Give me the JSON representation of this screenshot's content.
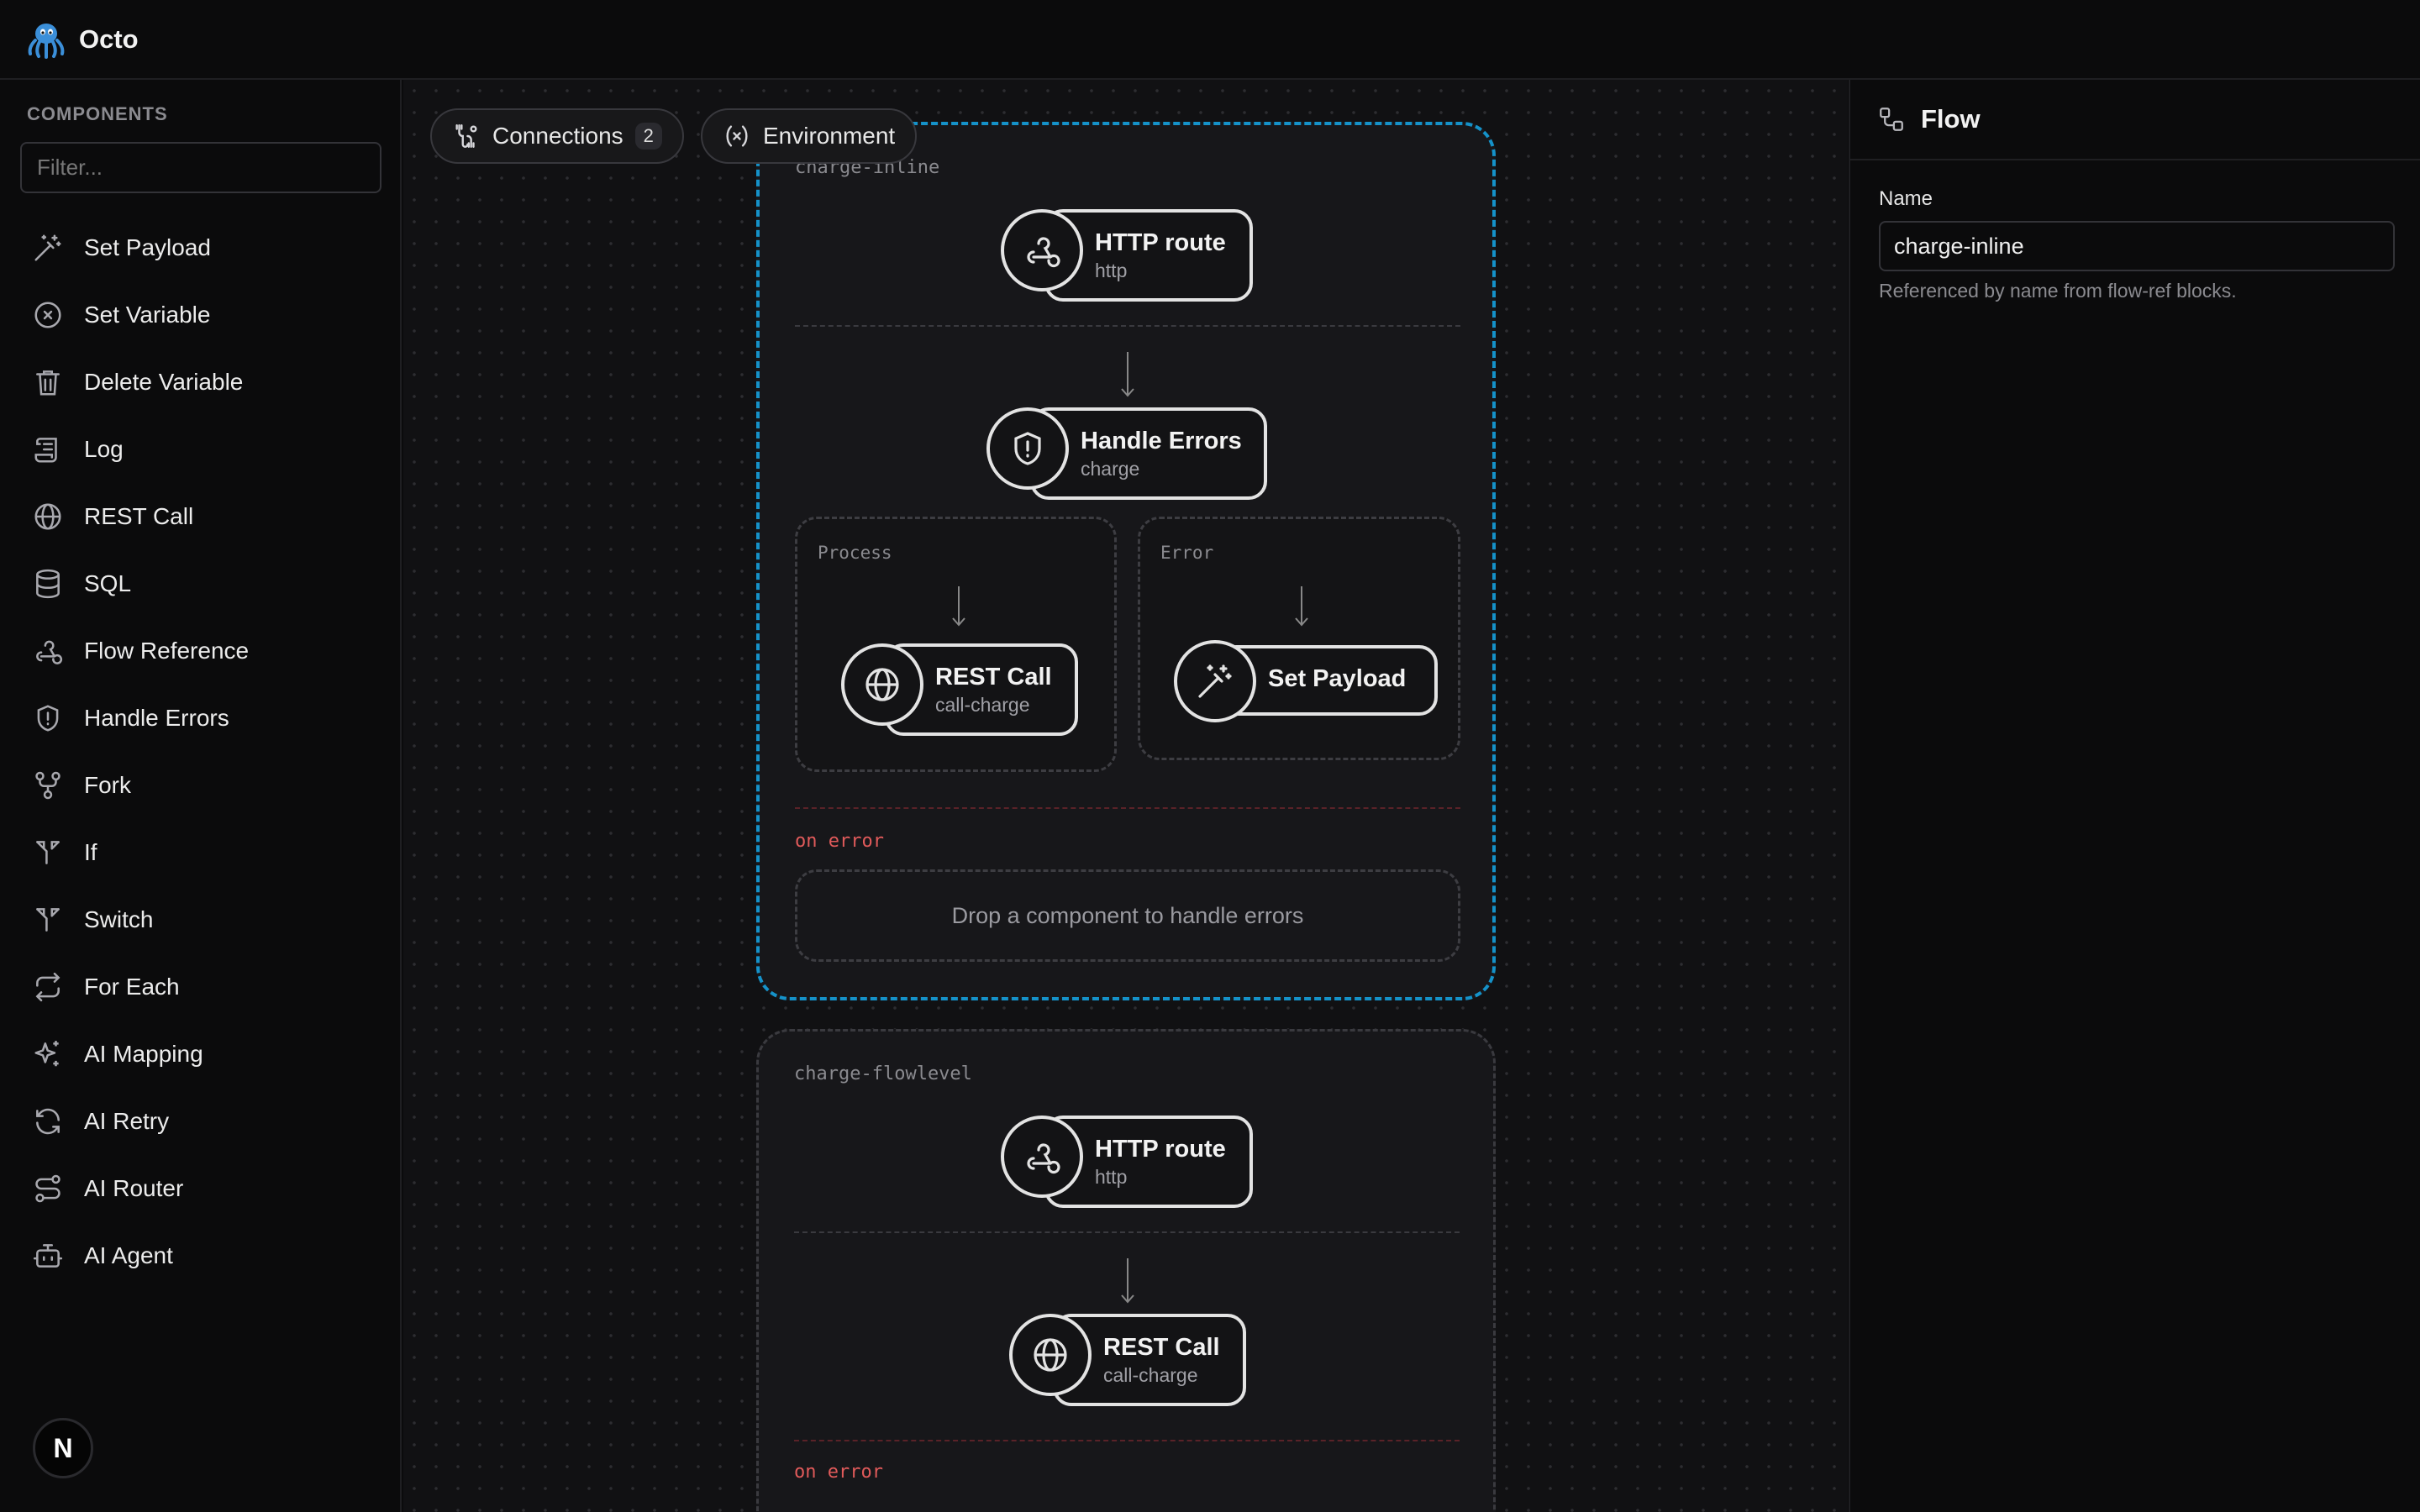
{
  "app": {
    "title": "Octo"
  },
  "sidebar": {
    "heading": "COMPONENTS",
    "filter_placeholder": "Filter...",
    "items": [
      {
        "label": "Set Payload",
        "icon": "magic-wand-icon"
      },
      {
        "label": "Set Variable",
        "icon": "variable-icon"
      },
      {
        "label": "Delete Variable",
        "icon": "trash-icon"
      },
      {
        "label": "Log",
        "icon": "scroll-icon"
      },
      {
        "label": "REST Call",
        "icon": "globe-icon"
      },
      {
        "label": "SQL",
        "icon": "database-icon"
      },
      {
        "label": "Flow Reference",
        "icon": "webhook-icon"
      },
      {
        "label": "Handle Errors",
        "icon": "shield-icon"
      },
      {
        "label": "Fork",
        "icon": "fork-icon"
      },
      {
        "label": "If",
        "icon": "split-icon"
      },
      {
        "label": "Switch",
        "icon": "split-icon"
      },
      {
        "label": "For Each",
        "icon": "repeat-icon"
      },
      {
        "label": "AI Mapping",
        "icon": "sparkles-icon"
      },
      {
        "label": "AI Retry",
        "icon": "refresh-icon"
      },
      {
        "label": "AI Router",
        "icon": "route-icon"
      },
      {
        "label": "AI Agent",
        "icon": "bot-icon"
      }
    ],
    "avatar_letter": "N"
  },
  "toolbar": {
    "connections_label": "Connections",
    "connections_count": "2",
    "environment_label": "Environment"
  },
  "flows": [
    {
      "name": "charge-inline",
      "trigger": {
        "title": "HTTP route",
        "sub": "http"
      },
      "handler": {
        "title": "Handle Errors",
        "sub": "charge"
      },
      "process_label": "Process",
      "process_node": {
        "title": "REST Call",
        "sub": "call-charge"
      },
      "error_label": "Error",
      "error_node": {
        "title": "Set Payload"
      },
      "on_error_label": "on error",
      "dropzone_text": "Drop a component to handle errors"
    },
    {
      "name": "charge-flowlevel",
      "trigger": {
        "title": "HTTP route",
        "sub": "http"
      },
      "node": {
        "title": "REST Call",
        "sub": "call-charge"
      },
      "on_error_label": "on error"
    }
  ],
  "panel": {
    "title": "Flow",
    "name_label": "Name",
    "name_value": "charge-inline",
    "help_text": "Referenced by name from flow-ref blocks."
  },
  "colors": {
    "selected_border": "#1592c9",
    "error_text": "#e05a5a",
    "background": "#0b0b0c"
  }
}
